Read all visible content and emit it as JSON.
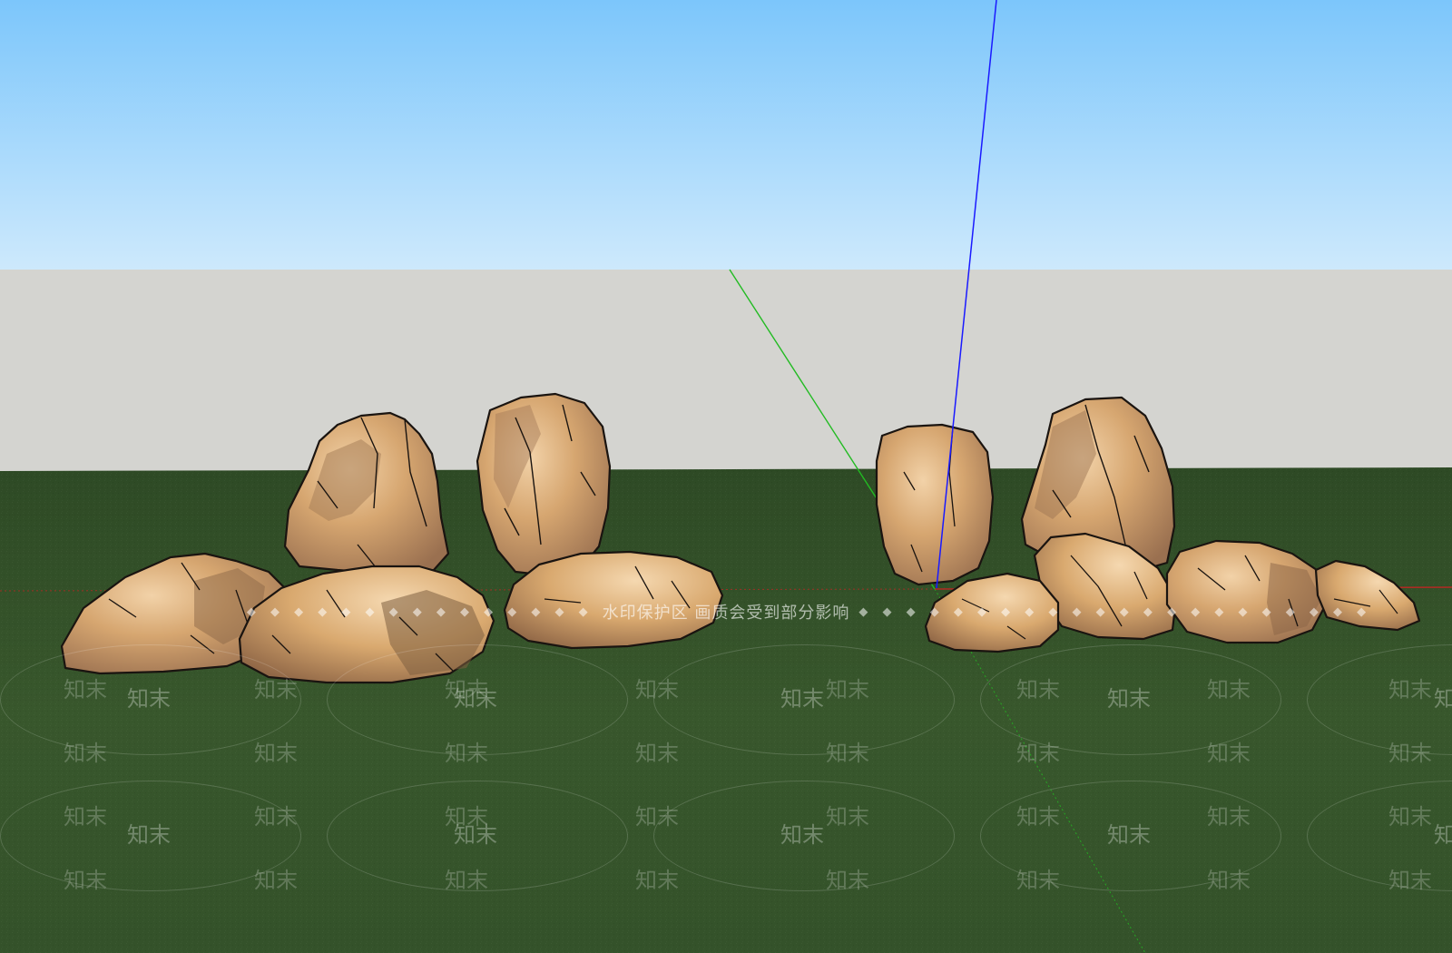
{
  "scene": {
    "sky_top_color": "#7cc6fb",
    "sky_bottom_color": "#cde9fc",
    "wall_color": "#d4d4d0",
    "ground_color": "#34522a",
    "stone_base_color": "#d6a670",
    "stone_shadow_color": "#9a7050",
    "stone_highlight_color": "#f2d2a8",
    "axis_blue": "#1a1aff",
    "axis_green": "#22bb22",
    "axis_red": "#cc2222"
  },
  "watermark": {
    "banner_text": "水印保护区   画质会受到部分影响",
    "diamonds_left": "◆ ◆ ◆ ◆ ◆ ◆ ◆ ◆ ◆ ◆ ◆ ◆ ◆ ◆ ◆",
    "diamonds_right": "◆ ◆ ◆ ◆ ◆ ◆ ◆ ◆ ◆ ◆ ◆ ◆ ◆ ◆ ◆ ◆ ◆ ◆ ◆ ◆ ◆ ◆",
    "tile_text": "知末"
  }
}
